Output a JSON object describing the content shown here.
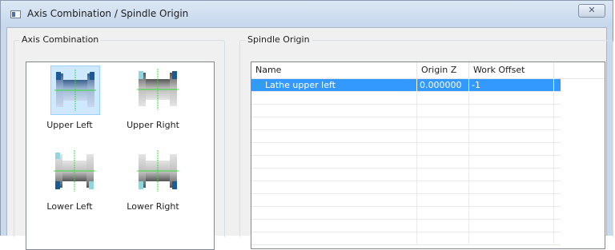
{
  "window": {
    "title": "Axis Combination / Spindle Origin",
    "close_label": "✕"
  },
  "axis_combination": {
    "group_label": "Axis Combination",
    "selected": "Upper Left",
    "items": [
      {
        "label": "Upper Left",
        "icon": "upper-left-axis-icon"
      },
      {
        "label": "Upper Right",
        "icon": "upper-right-axis-icon"
      },
      {
        "label": "Lower Left",
        "icon": "lower-left-axis-icon"
      },
      {
        "label": "Lower Right",
        "icon": "lower-right-axis-icon"
      }
    ]
  },
  "spindle_origin": {
    "group_label": "Spindle Origin",
    "columns": [
      "Name",
      "Origin Z",
      "Work Offset"
    ],
    "rows": [
      {
        "name": "Lathe upper left",
        "origin_z": "0.000000",
        "work_offset": "-1",
        "checked": true,
        "selected": true
      }
    ]
  },
  "colors": {
    "selection": "#3399ff",
    "checkmark": "#2aa7d8",
    "axis_green": "#33dd33",
    "spindle_blue": "#1c5a95"
  }
}
